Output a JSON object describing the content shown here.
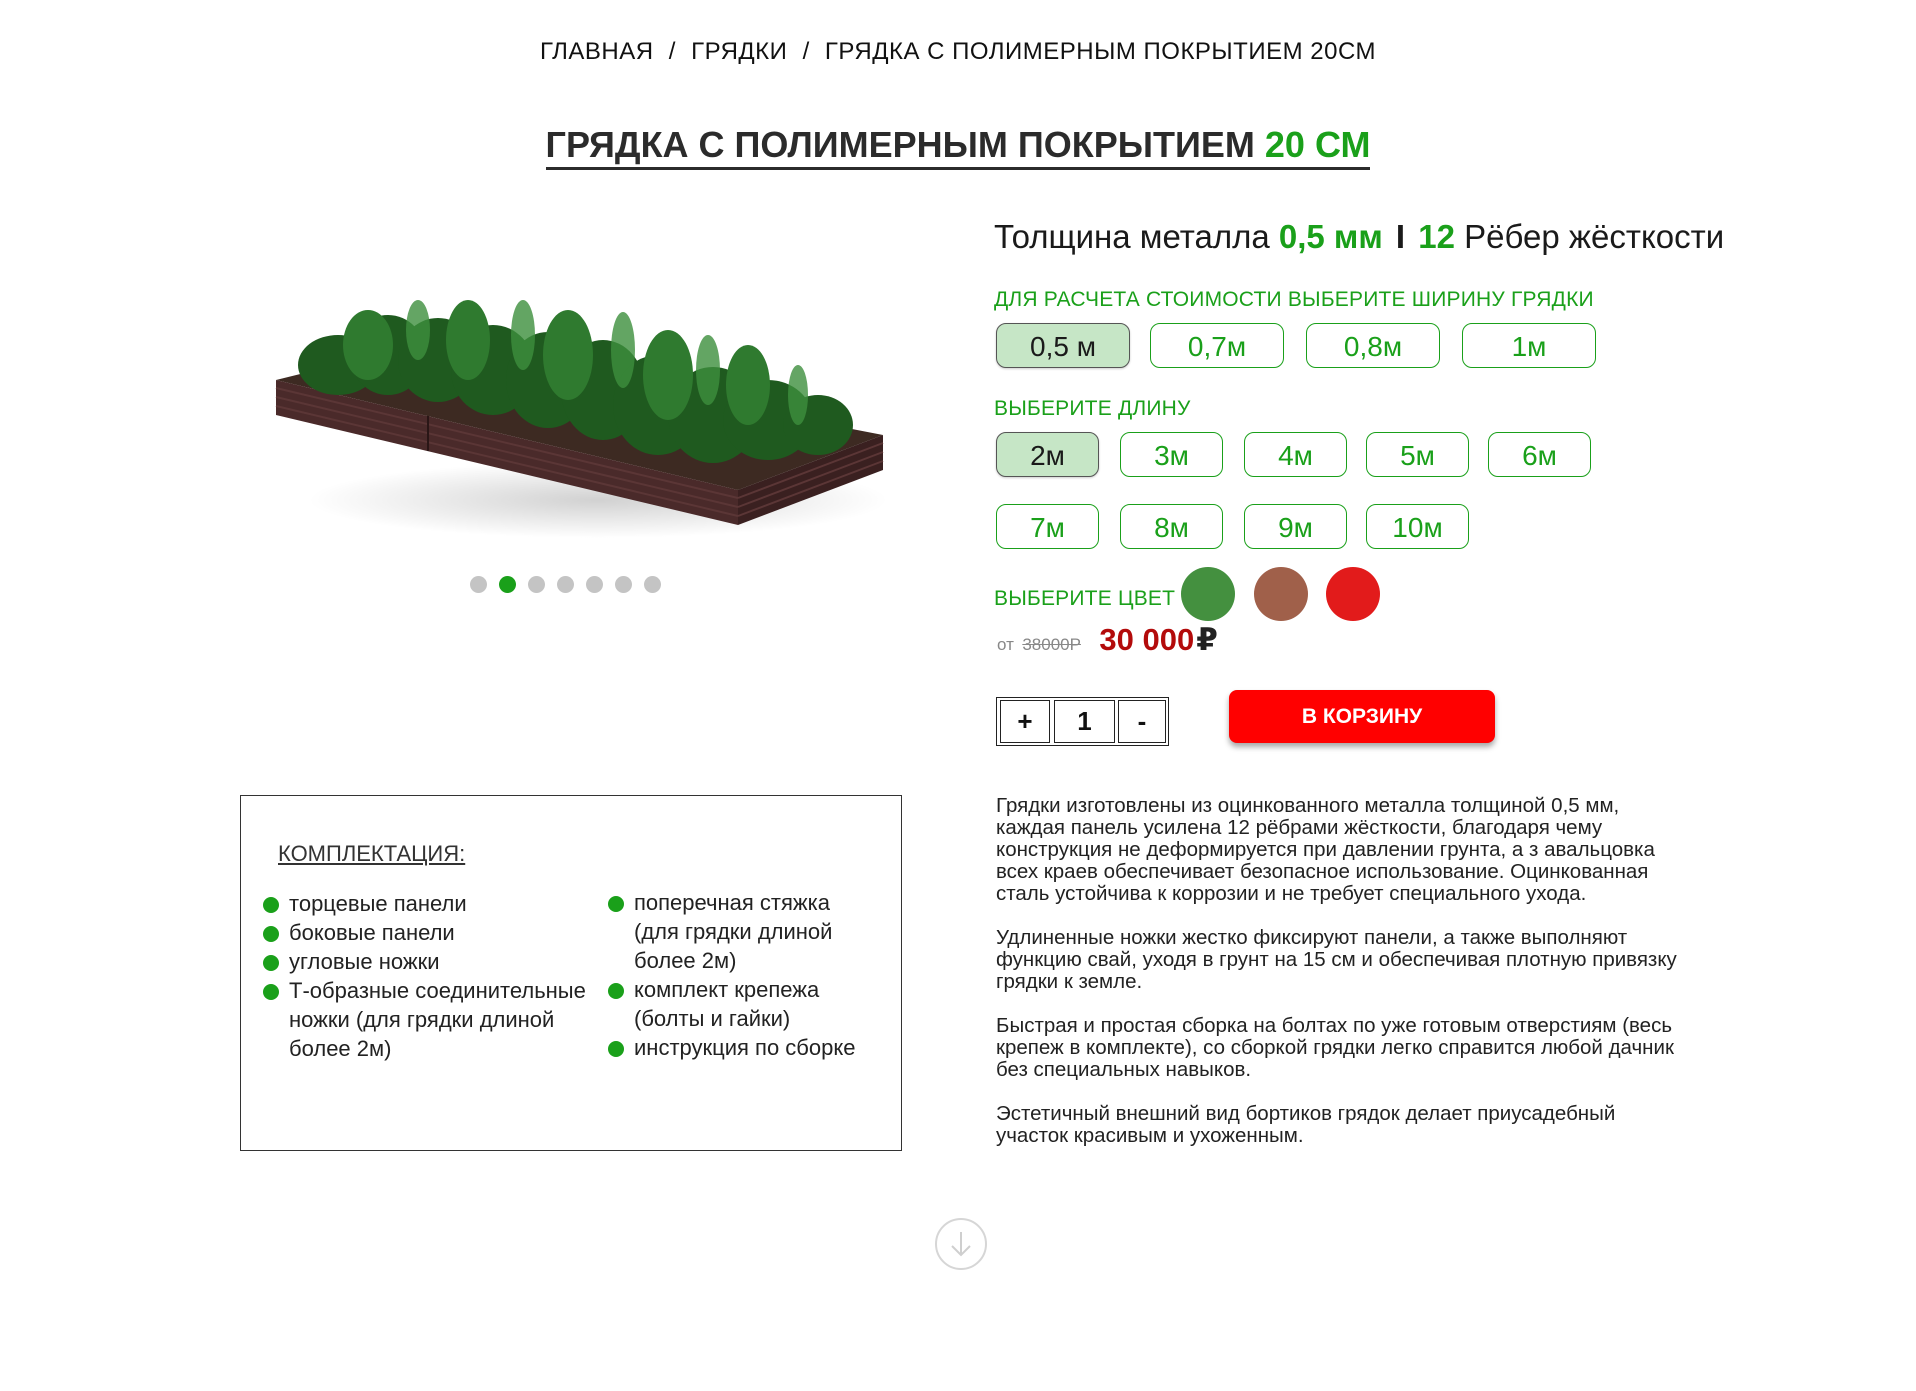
{
  "breadcrumb": {
    "home": "ГЛАВНАЯ",
    "category": "ГРЯДКИ",
    "current": "ГРЯДКА С ПОЛИМЕРНЫМ ПОКРЫТИЕМ 20СМ",
    "separator": "/"
  },
  "title": {
    "main": "ГРЯДКА С ПОЛИМЕРНЫМ ПОКРЫТИЕМ",
    "accent": "20 СМ"
  },
  "slider": {
    "dot_count": 7,
    "active_index": 1
  },
  "specs": {
    "thickness_label": "Толщина металла",
    "thickness_value": "0,5 мм",
    "divider": "I",
    "ribs_value": "12",
    "ribs_label": "Рёбер жёсткости"
  },
  "width_section": {
    "label": "ДЛЯ РАСЧЕТА СТОИМОСТИ ВЫБЕРИТЕ ШИРИНУ ГРЯДКИ",
    "options": [
      "0,5 м",
      "0,7м",
      "0,8м",
      "1м"
    ],
    "selected_index": 0
  },
  "length_section": {
    "label": "ВЫБЕРИТЕ ДЛИНУ",
    "options": [
      "2м",
      "3м",
      "4м",
      "5м",
      "6м",
      "7м",
      "8м",
      "9м",
      "10м"
    ],
    "selected_index": 0
  },
  "color_section": {
    "label": "ВЫБЕРИТЕ ЦВЕТ",
    "swatches": [
      "#44903f",
      "#a0604a",
      "#e21b1b"
    ]
  },
  "price": {
    "prefix": "от",
    "old": "38000Р",
    "current": "30 000",
    "currency": "₽"
  },
  "quantity": {
    "plus": "+",
    "value": "1",
    "minus": "-"
  },
  "cart_button": "В КОРЗИНУ",
  "kit": {
    "title": "КОМПЛЕКТАЦИЯ:",
    "col1": [
      "торцевые панели",
      "боковые панели",
      "угловые ножки",
      "Т-образные соединительные ножки (для грядки длиной более 2м)"
    ],
    "col2": [
      "поперечная стяжка (для грядки длиной более 2м)",
      "комплект крепежа (болты и гайки)",
      "инструкция по сборке"
    ]
  },
  "description": [
    "Грядки изготовлены из оцинкованного металла толщиной 0,5 мм, каждая панель усилена 12 рёбрами жёсткости, благодаря чему конструкция не деформируется при давлении грунта, а з авальцовка всех краев обеспечивает безопасное использование. Оцинкованная сталь устойчива к коррозии и не требует специального ухода.",
    "Удлиненные ножки жестко фиксируют панели, а также выполняют функцию свай, уходя в грунт на 15 см и обеспечивая плотную привязку грядки к земле.",
    "Быстрая и простая сборка на болтах по уже готовым отверстиям (весь крепеж в комплекте), со сборкой грядки легко справится любой дачник без специальных навыков.",
    "Эстетичный внешний вид бортиков грядок делает приусадебный участок красивым и ухоженным."
  ],
  "icons": {
    "scroll": "arrow-down-circle-icon",
    "bullet": "green-dot-icon"
  },
  "colors": {
    "accent": "#1aa01a",
    "price": "#b30b0b",
    "cart": "#ff0000",
    "bed": "#4a2a2a"
  }
}
